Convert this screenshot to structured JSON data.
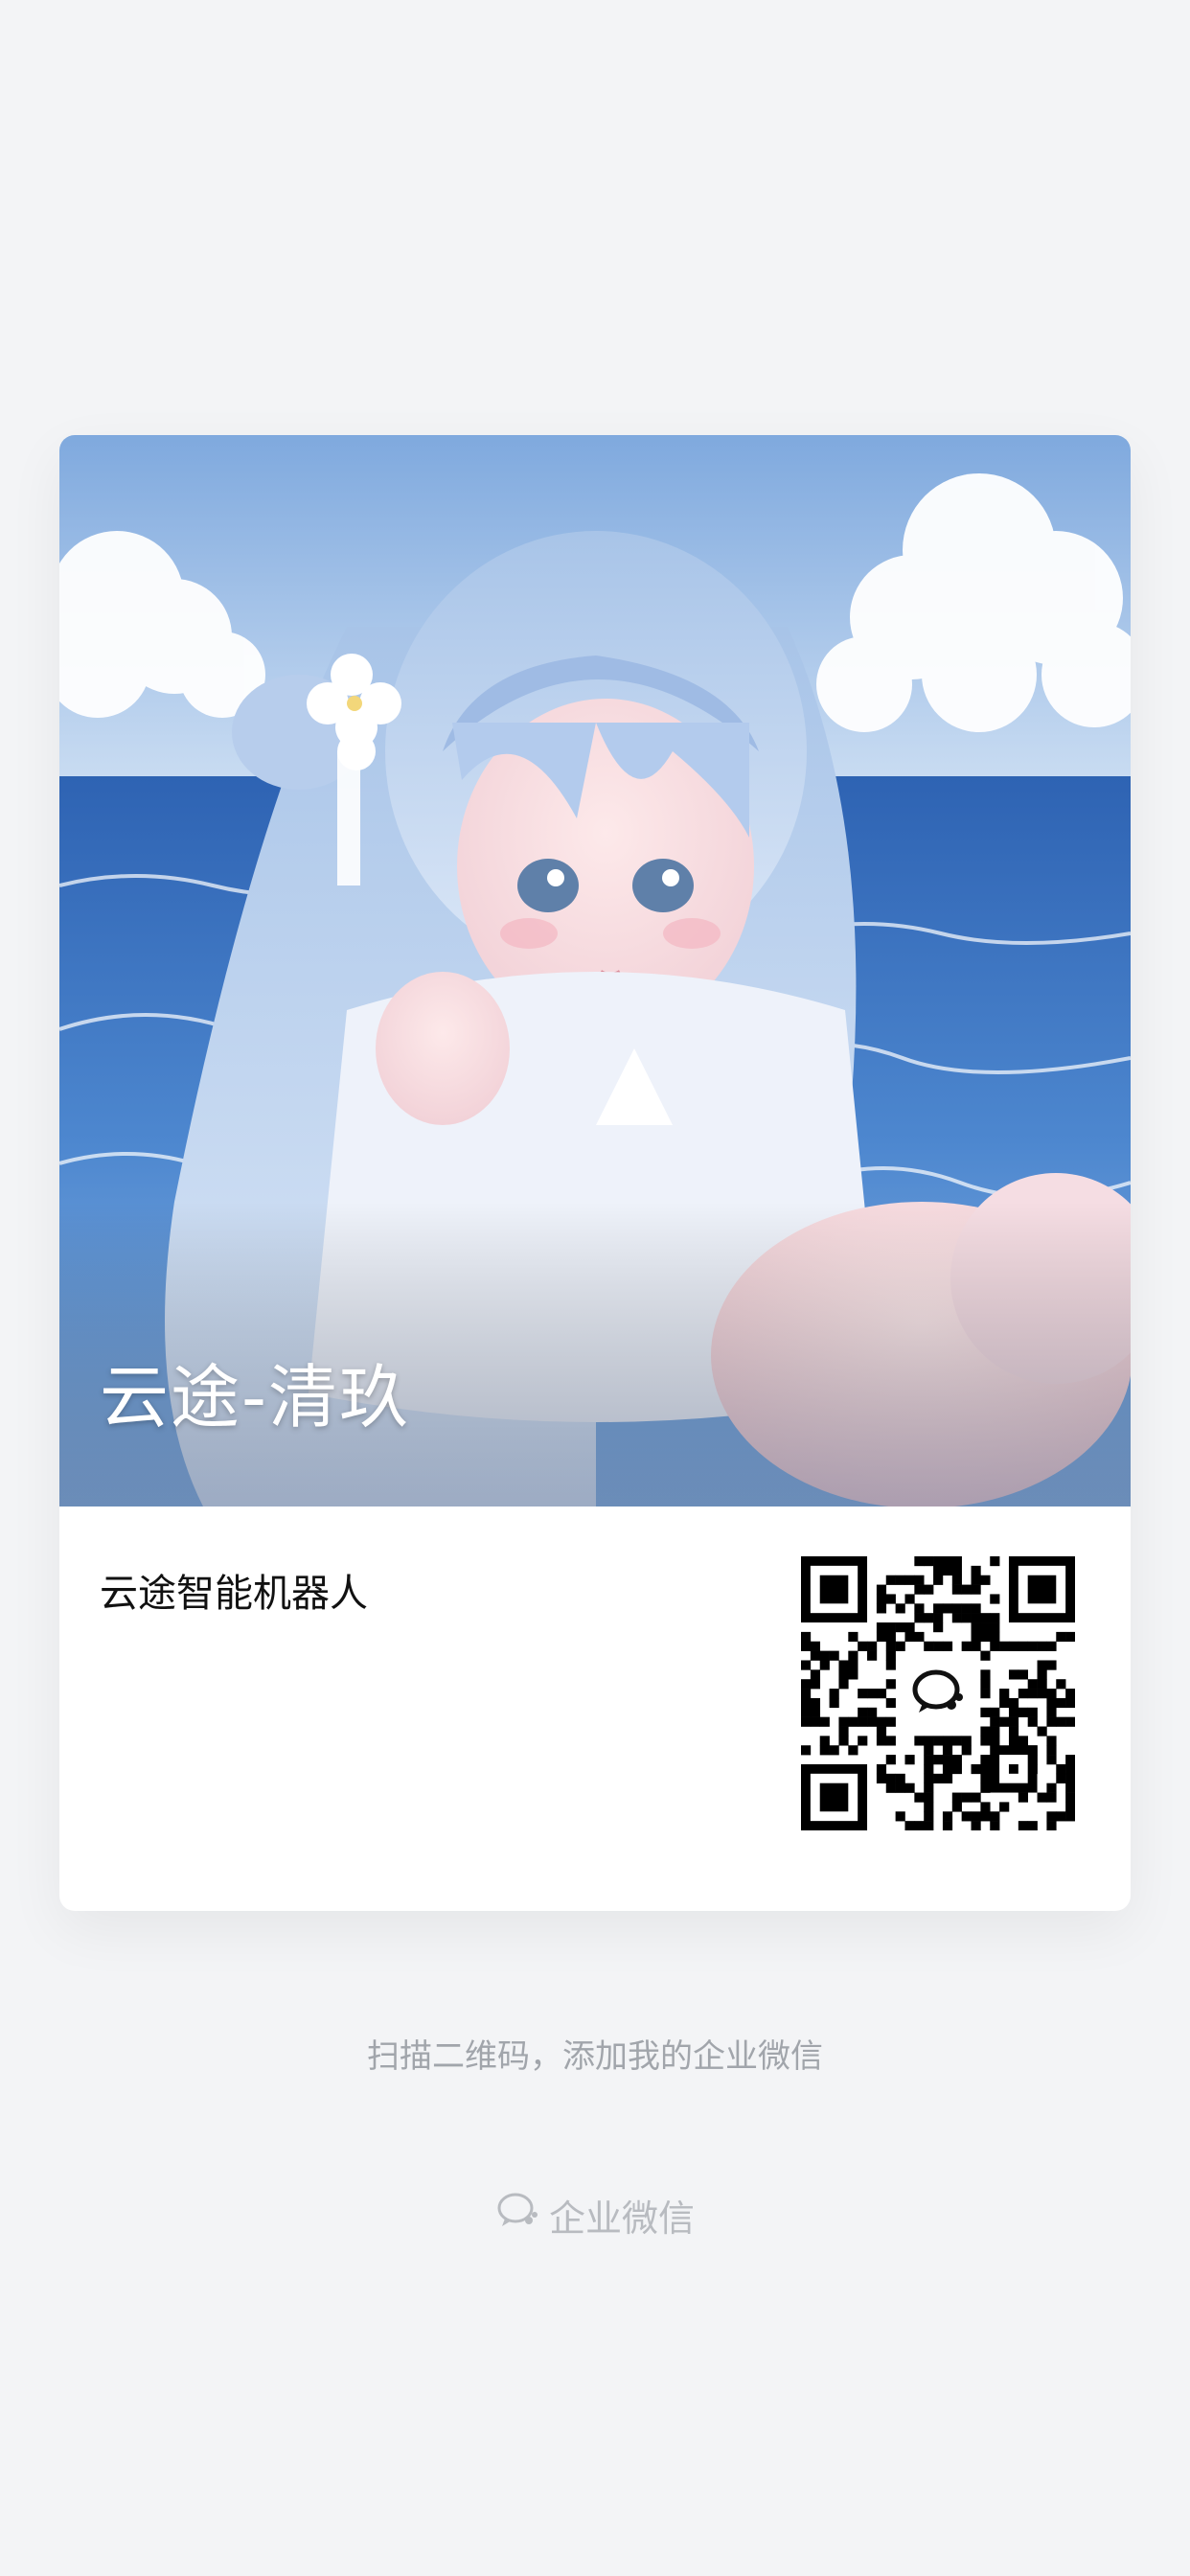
{
  "card": {
    "title": "云途-清玖",
    "company": "云途智能机器人",
    "qr_icon": "wecom-logo-icon"
  },
  "hint": "扫描二维码，添加我的企业微信",
  "brand": {
    "icon": "wecom-logo-icon",
    "label": "企业微信"
  }
}
